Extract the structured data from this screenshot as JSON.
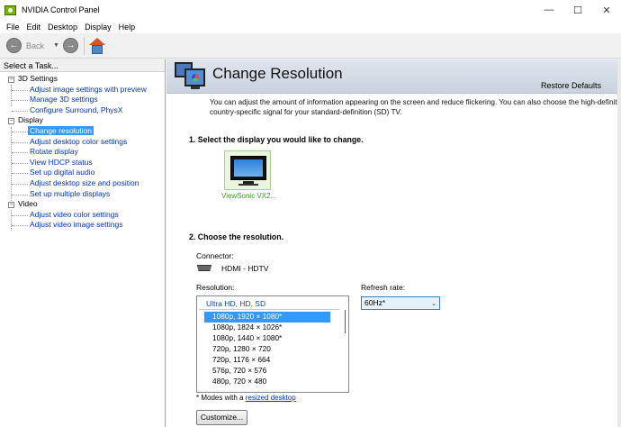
{
  "window": {
    "title": "NVIDIA Control Panel",
    "controls": {
      "minimize": "—",
      "maximize": "☐",
      "close": "✕"
    }
  },
  "menu": [
    "File",
    "Edit",
    "Desktop",
    "Display",
    "Help"
  ],
  "toolbar": {
    "back_label": "Back"
  },
  "sidebar": {
    "header": "Select a Task...",
    "categories": [
      {
        "label": "3D Settings",
        "items": [
          "Adjust image settings with preview",
          "Manage 3D settings",
          "Configure Surround, PhysX"
        ]
      },
      {
        "label": "Display",
        "items": [
          "Change resolution",
          "Adjust desktop color settings",
          "Rotate display",
          "View HDCP status",
          "Set up digital audio",
          "Adjust desktop size and position",
          "Set up multiple displays"
        ]
      },
      {
        "label": "Video",
        "items": [
          "Adjust video color settings",
          "Adjust video image settings"
        ]
      }
    ],
    "selected": "Change resolution"
  },
  "main": {
    "title": "Change Resolution",
    "restore_defaults": "Restore Defaults",
    "description_line1": "You can adjust the amount of information appearing on the screen and reduce flickering. You can also choose the high-definition (H",
    "description_line2": "country-specific signal for your standard-definition (SD) TV.",
    "step1": "1. Select the display you would like to change.",
    "display_name": "ViewSonic VX2...",
    "step2": "2. Choose the resolution.",
    "connector_label": "Connector:",
    "connector_value": "HDMI - HDTV",
    "resolution_label": "Resolution:",
    "refresh_label": "Refresh rate:",
    "refresh_value": "60Hz*",
    "list_header": "Ultra HD, HD, SD",
    "resolutions": [
      "1080p, 1920 × 1080*",
      "1080p, 1824 × 1026*",
      "1080p, 1440 × 1080*",
      "720p, 1280 × 720",
      "720p, 1176 × 664",
      "576p, 720 × 576",
      "480p, 720 × 480"
    ],
    "selected_resolution": "1080p, 1920 × 1080*",
    "note_prefix": "* Modes with a",
    "note_link": "resized desktop",
    "customize_button": "Customize..."
  },
  "colors": {
    "accent_selection": "#3399ff",
    "link": "#0033cc",
    "nvidia_green": "#76b900"
  }
}
